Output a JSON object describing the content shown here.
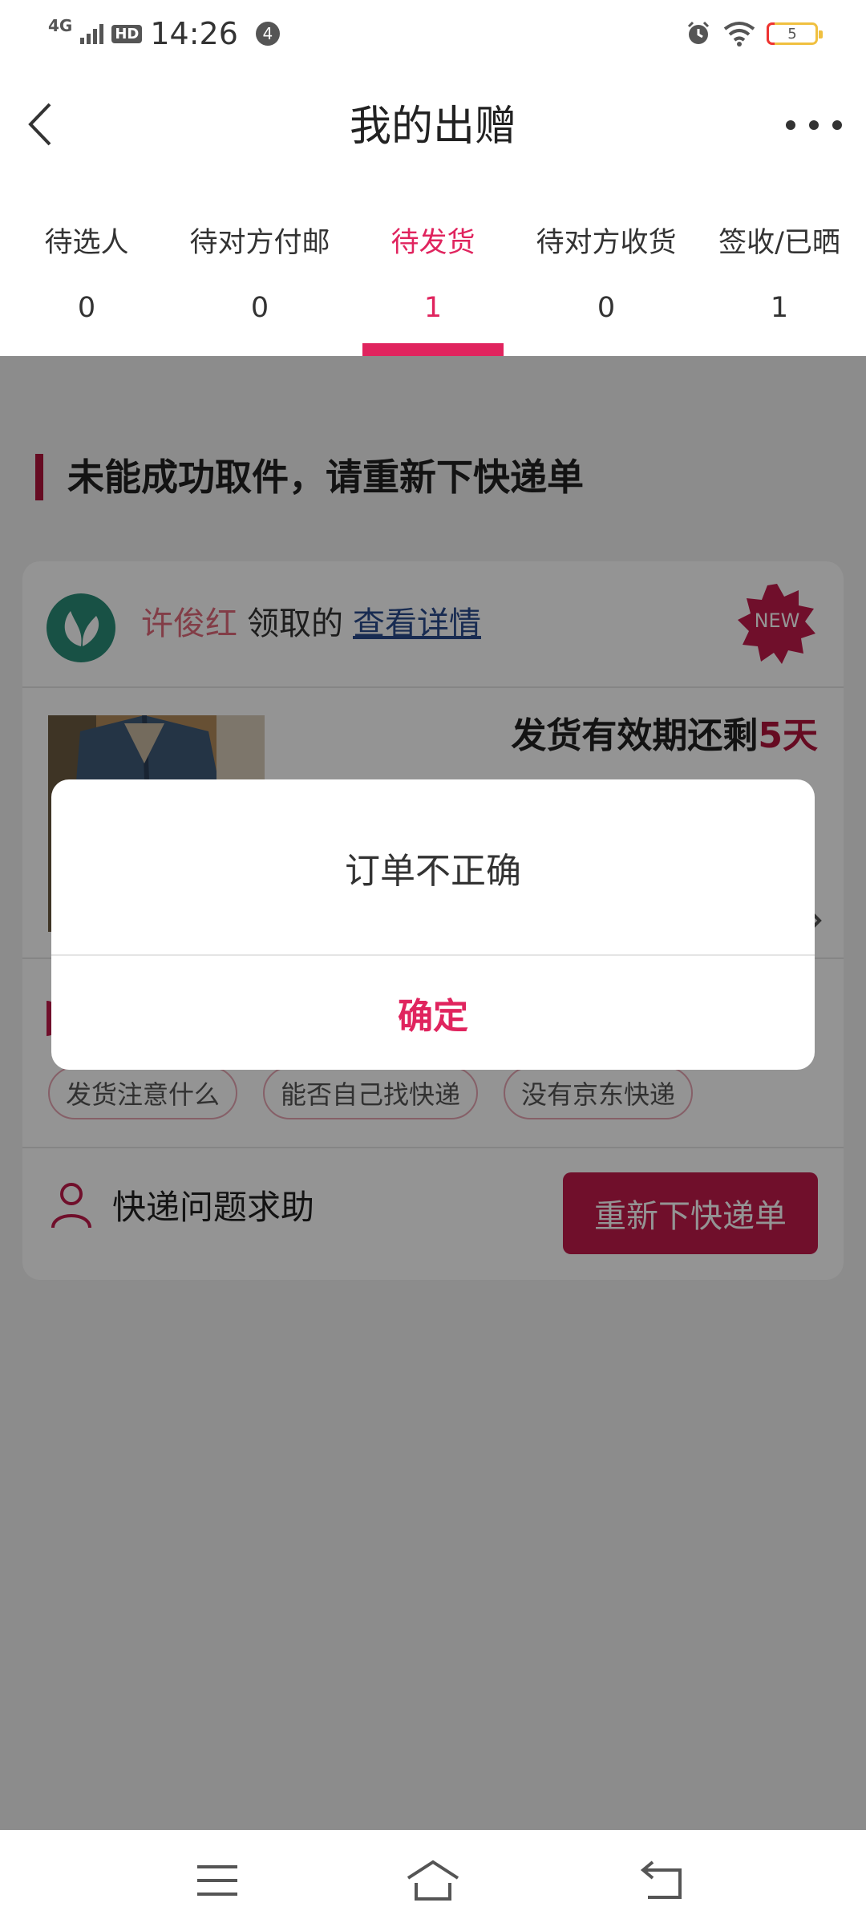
{
  "status_bar": {
    "network": "4G",
    "hd": "HD",
    "time": "14:26",
    "notification_count": "4",
    "battery": "5"
  },
  "header": {
    "title": "我的出赠"
  },
  "tabs": [
    {
      "label": "待选人",
      "count": "0"
    },
    {
      "label": "待对方付邮",
      "count": "0"
    },
    {
      "label": "待发货",
      "count": "1",
      "active": true
    },
    {
      "label": "待对方收货",
      "count": "0"
    },
    {
      "label": "签收/已晒",
      "count": "1"
    }
  ],
  "section": {
    "title": "未能成功取件，请重新下快递单"
  },
  "card": {
    "giver_name": "许俊红",
    "giver_action": "领取的",
    "detail_link": "查看详情",
    "new_badge": "NEW",
    "deadline_prefix": "发货有效期还剩",
    "deadline_days": "5天",
    "tags": [
      "发货注意什么",
      "能否自己找快递",
      "没有京东快递"
    ],
    "help_label": "快递问题求助",
    "reorder_button": "重新下快递单"
  },
  "dialog": {
    "message": "订单不正确",
    "confirm": "确定"
  },
  "colors": {
    "accent": "#e0245e",
    "button": "#c21a4b",
    "overlay": "rgba(0,0,0,0.42)"
  }
}
